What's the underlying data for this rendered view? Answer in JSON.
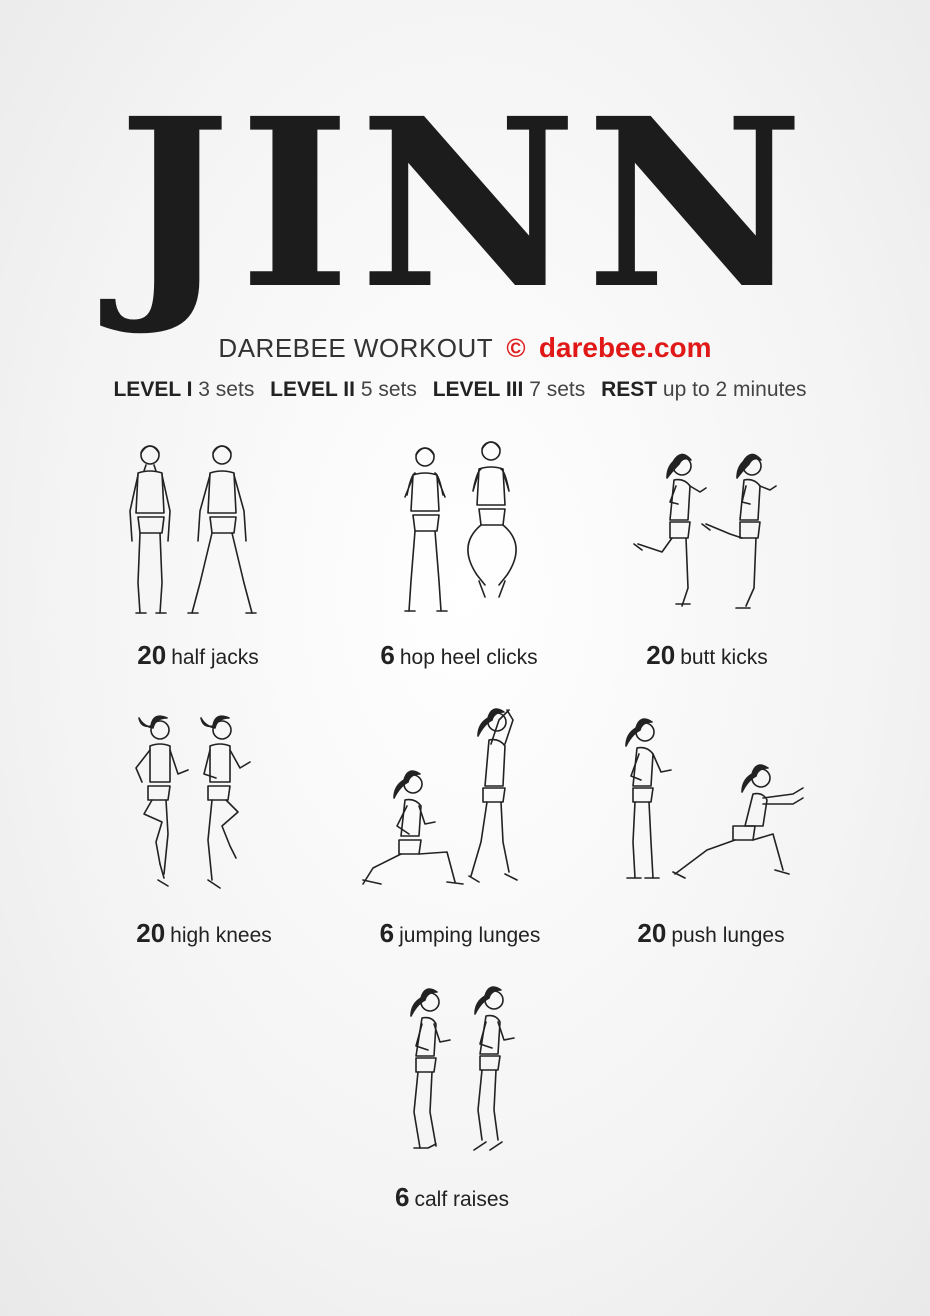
{
  "title": "JINN",
  "header": {
    "label": "DAREBEE WORKOUT",
    "copyright_symbol": "©",
    "site": "darebee.com",
    "accent_color": "#e01818"
  },
  "levels": [
    {
      "name": "LEVEL I",
      "value": "3 sets"
    },
    {
      "name": "LEVEL II",
      "value": "5 sets"
    },
    {
      "name": "LEVEL III",
      "value": "7 sets"
    },
    {
      "name": "REST",
      "value": "up to 2 minutes"
    }
  ],
  "exercises": [
    {
      "count": "20",
      "name": "half jacks"
    },
    {
      "count": "6",
      "name": "hop heel clicks"
    },
    {
      "count": "20",
      "name": "butt kicks"
    },
    {
      "count": "20",
      "name": "high knees"
    },
    {
      "count": "6",
      "name": "jumping lunges"
    },
    {
      "count": "20",
      "name": "push lunges"
    },
    {
      "count": "6",
      "name": "calf raises"
    }
  ]
}
